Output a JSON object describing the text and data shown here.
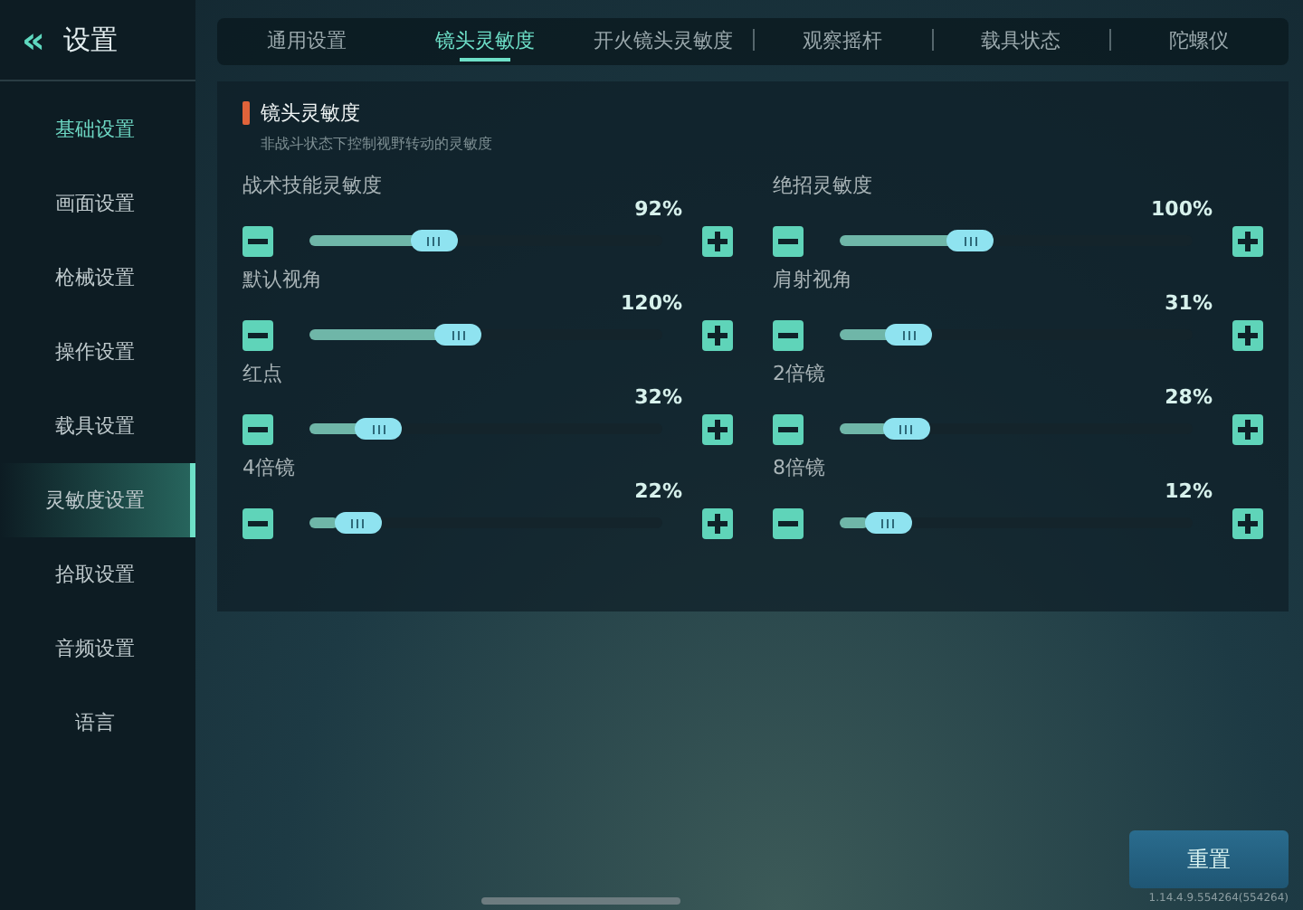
{
  "header": {
    "back_icon": "«",
    "title": "设置"
  },
  "sidebar": {
    "items": [
      {
        "label": "基础设置",
        "kind": "header",
        "selected": false
      },
      {
        "label": "画面设置",
        "kind": "item",
        "selected": false
      },
      {
        "label": "枪械设置",
        "kind": "item",
        "selected": false
      },
      {
        "label": "操作设置",
        "kind": "item",
        "selected": false
      },
      {
        "label": "载具设置",
        "kind": "item",
        "selected": false
      },
      {
        "label": "灵敏度设置",
        "kind": "item",
        "selected": true
      },
      {
        "label": "拾取设置",
        "kind": "item",
        "selected": false
      },
      {
        "label": "音频设置",
        "kind": "item",
        "selected": false
      },
      {
        "label": "语言",
        "kind": "item",
        "selected": false
      }
    ]
  },
  "tabs": [
    {
      "label": "通用设置",
      "selected": false
    },
    {
      "label": "镜头灵敏度",
      "selected": true
    },
    {
      "label": "开火镜头灵敏度",
      "selected": false
    },
    {
      "label": "观察摇杆",
      "selected": false
    },
    {
      "label": "载具状态",
      "selected": false
    },
    {
      "label": "陀螺仪",
      "selected": false
    }
  ],
  "section": {
    "title": "镜头灵敏度",
    "description": "非战斗状态下控制视野转动的灵敏度"
  },
  "sliders": [
    {
      "name": "战术技能灵敏度",
      "reading": "92%",
      "level": 0.33
    },
    {
      "name": "绝招灵敏度",
      "reading": "100%",
      "level": 0.35
    },
    {
      "name": "默认视角",
      "reading": "120%",
      "level": 0.41
    },
    {
      "name": "肩射视角",
      "reading": "31%",
      "level": 0.15
    },
    {
      "name": "红点",
      "reading": "32%",
      "level": 0.15
    },
    {
      "name": "2倍镜",
      "reading": "28%",
      "level": 0.14
    },
    {
      "name": "4倍镜",
      "reading": "22%",
      "level": 0.08
    },
    {
      "name": "8倍镜",
      "reading": "12%",
      "level": 0.08
    }
  ],
  "reset_button": "重置",
  "version": "1.14.4.9.554264(554264)"
}
